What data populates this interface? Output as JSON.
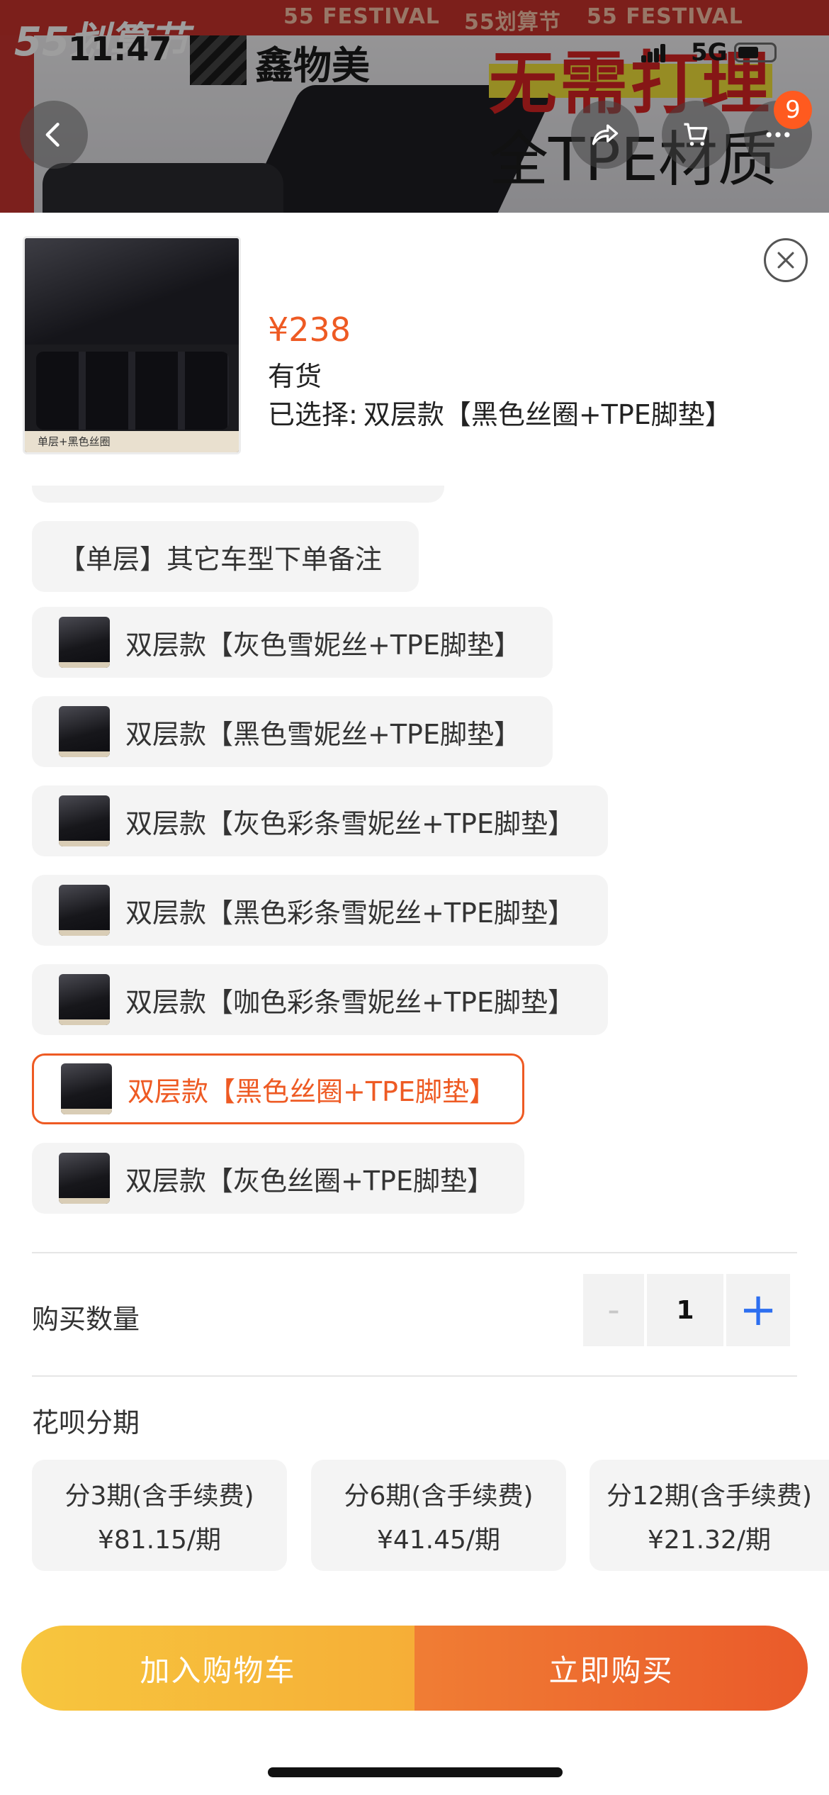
{
  "status_bar": {
    "time": "11:47",
    "network": "5G"
  },
  "banner": {
    "festival_logo": "55划算节",
    "festival_strip": [
      "55 FESTIVAL",
      "55划算节",
      "55 FESTIVAL"
    ],
    "brand": "鑫物美",
    "slogan_main": "无需打理",
    "slogan_sub": "全TPE材质",
    "cart_badge": "9",
    "icons": [
      "back-icon",
      "share-icon",
      "cart-icon",
      "more-icon"
    ]
  },
  "product": {
    "thumbnail_caption": "单层+黑色丝圈",
    "price": "¥238",
    "stock": "有货",
    "selected_prefix": "已选择:",
    "selected_value": "双层款【黑色丝圈+TPE脚垫】"
  },
  "options": [
    {
      "label": "【单层】其它车型下单备注",
      "has_image": false,
      "selected": false
    },
    {
      "label": "双层款【灰色雪妮丝+TPE脚垫】",
      "has_image": true,
      "selected": false
    },
    {
      "label": "双层款【黑色雪妮丝+TPE脚垫】",
      "has_image": true,
      "selected": false
    },
    {
      "label": "双层款【灰色彩条雪妮丝+TPE脚垫】",
      "has_image": true,
      "selected": false
    },
    {
      "label": "双层款【黑色彩条雪妮丝+TPE脚垫】",
      "has_image": true,
      "selected": false
    },
    {
      "label": "双层款【咖色彩条雪妮丝+TPE脚垫】",
      "has_image": true,
      "selected": false
    },
    {
      "label": "双层款【黑色丝圈+TPE脚垫】",
      "has_image": true,
      "selected": true
    },
    {
      "label": "双层款【灰色丝圈+TPE脚垫】",
      "has_image": true,
      "selected": false
    }
  ],
  "quantity": {
    "label": "购买数量",
    "minus": "-",
    "value": "1",
    "plus": "+"
  },
  "installments": {
    "label": "花呗分期",
    "plans": [
      {
        "title": "分3期(含手续费)",
        "amount": "¥81.15/期"
      },
      {
        "title": "分6期(含手续费)",
        "amount": "¥41.45/期"
      },
      {
        "title": "分12期(含手续费)",
        "amount": "¥21.32/期"
      }
    ]
  },
  "actions": {
    "add_to_cart": "加入购物车",
    "buy_now": "立即购买"
  },
  "colors": {
    "accent": "#ee5a23",
    "plus_blue": "#2d6ff0",
    "cart_yellow": "#f7c63e",
    "buy_orange": "#ea5a2a"
  }
}
